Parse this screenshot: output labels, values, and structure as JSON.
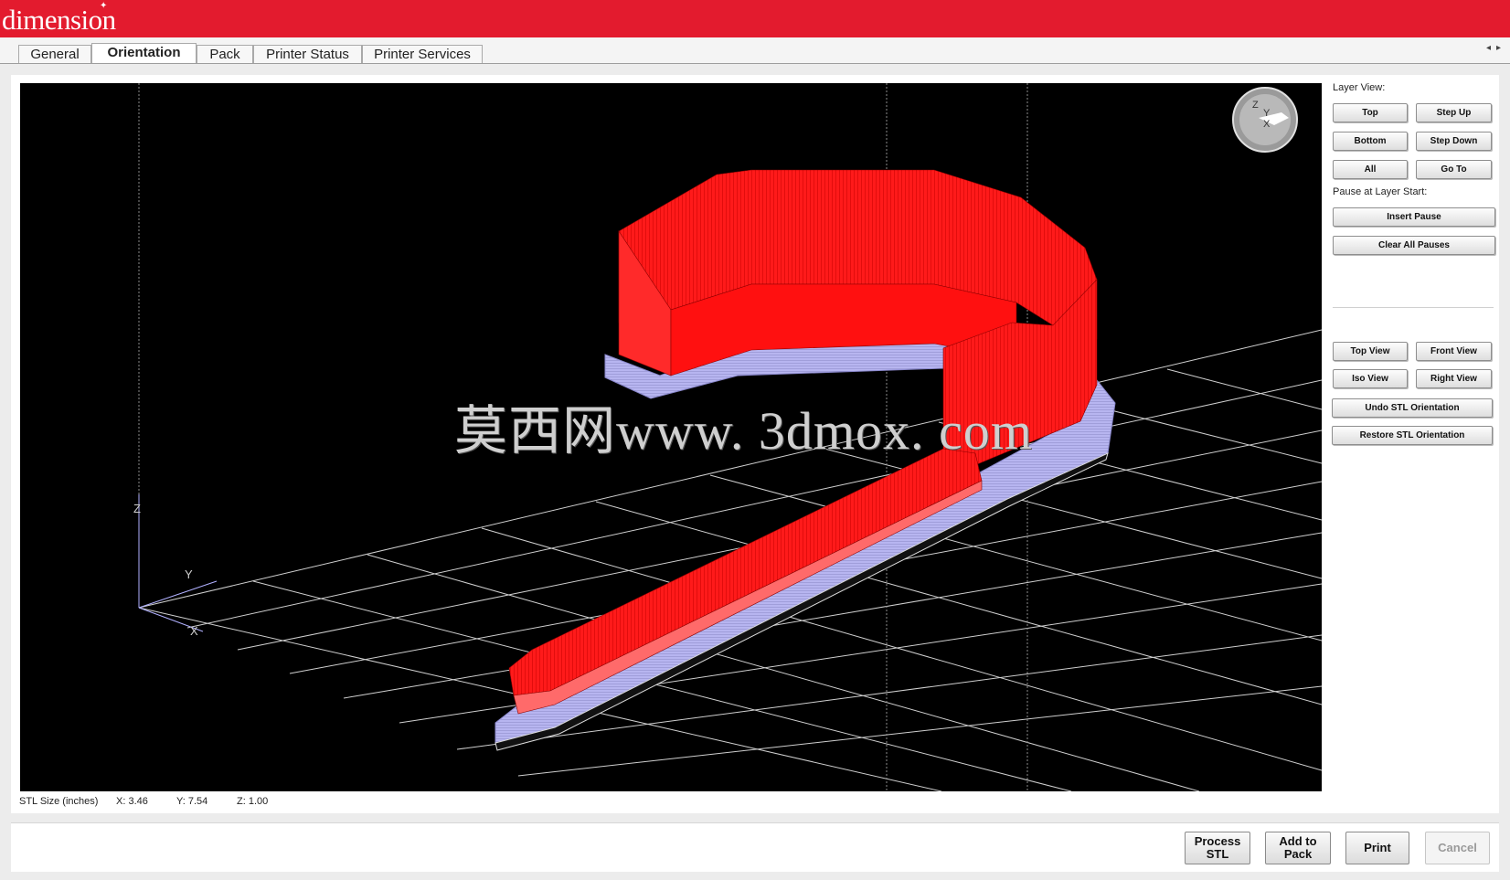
{
  "app": {
    "logo": "dimension",
    "logo_mark": "✦"
  },
  "tabs": [
    {
      "label": "General"
    },
    {
      "label": "Orientation",
      "active": true
    },
    {
      "label": "Pack"
    },
    {
      "label": "Printer Status"
    },
    {
      "label": "Printer Services"
    }
  ],
  "viewport": {
    "watermark": "莫西网www. 3dmox. com",
    "axis_labels": {
      "z": "Z",
      "y": "Y",
      "x": "X"
    },
    "orientation_cube": {
      "z": "Z",
      "y": "Y",
      "x": "X"
    },
    "model_color": "#ff1a1a",
    "support_color": "#b7b5f0",
    "grid_color": "#c8c8c8"
  },
  "stl_size": {
    "label": "STL Size (inches)",
    "x": "X: 3.46",
    "y": "Y: 7.54",
    "z": "Z: 1.00"
  },
  "layer_view": {
    "label": "Layer View:",
    "top": "Top",
    "step_up": "Step Up",
    "bottom": "Bottom",
    "step_down": "Step Down",
    "all": "All",
    "go_to": "Go To"
  },
  "pause": {
    "label": "Pause at Layer Start:",
    "insert": "Insert Pause",
    "clear": "Clear All Pauses"
  },
  "views": {
    "top_view": "Top View",
    "front_view": "Front View",
    "iso_view": "Iso View",
    "right_view": "Right View",
    "undo": "Undo STL Orientation",
    "restore": "Restore STL Orientation"
  },
  "actions": {
    "process_stl": "Process STL",
    "add_to_pack": "Add to Pack",
    "print": "Print",
    "cancel": "Cancel"
  }
}
